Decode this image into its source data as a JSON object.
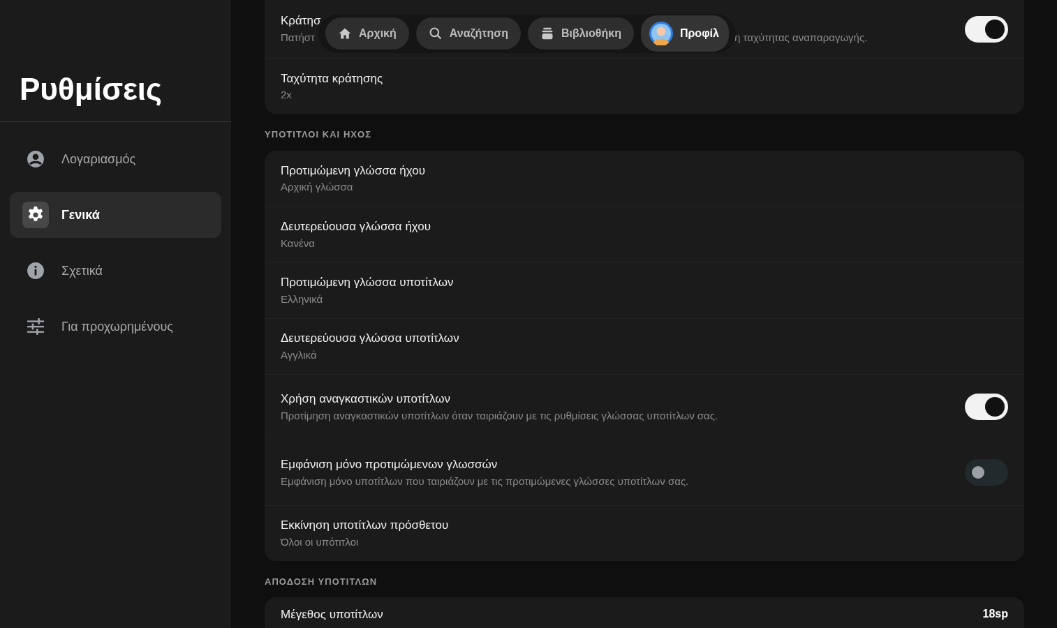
{
  "sidebar": {
    "title": "Ρυθμίσεις",
    "items": [
      {
        "label": "Λογαριασμός",
        "selected": false
      },
      {
        "label": "Γενικά",
        "selected": true
      },
      {
        "label": "Σχετικά",
        "selected": false
      },
      {
        "label": "Για προχωρημένους",
        "selected": false
      }
    ]
  },
  "nav": [
    {
      "label": "Αρχική",
      "selected": false
    },
    {
      "label": "Αναζήτηση",
      "selected": false
    },
    {
      "label": "Βιβλιοθήκη",
      "selected": false
    },
    {
      "label": "Προφίλ",
      "selected": true
    }
  ],
  "sections": [
    {
      "rows": [
        {
          "kind": "toggle",
          "title": "Κράτησ",
          "subtitle_parts": [
            "Πατήστ",
            "η ταχύτητας αναπαραγωγής."
          ],
          "on": true
        },
        {
          "kind": "value",
          "title": "Ταχύτητα κράτησης",
          "subtitle": "2x"
        }
      ]
    },
    {
      "heading": "ΥΠΟΤΙΤΛΟΙ ΚΑΙ ΗΧΟΣ",
      "rows": [
        {
          "kind": "value",
          "title": "Προτιμώμενη γλώσσα ήχου",
          "subtitle": "Αρχική γλώσσα"
        },
        {
          "kind": "value",
          "title": "Δευτερεύουσα γλώσσα ήχου",
          "subtitle": "Κανένα"
        },
        {
          "kind": "value",
          "title": "Προτιμώμενη γλώσσα υποτίτλων",
          "subtitle": "Ελληνικά"
        },
        {
          "kind": "value",
          "title": "Δευτερεύουσα γλώσσα υποτίτλων",
          "subtitle": "Αγγλικά"
        },
        {
          "kind": "toggle",
          "title": "Χρήση αναγκαστικών υποτίτλων",
          "subtitle": "Προτίμηση αναγκαστικών υποτίτλων όταν ταιριάζουν με τις ρυθμίσεις γλώσσας υποτίτλων σας.",
          "on": true
        },
        {
          "kind": "toggle",
          "title": "Εμφάνιση μόνο προτιμώμενων γλωσσών",
          "subtitle": "Εμφάνιση μόνο υποτίτλων που ταιριάζουν με τις προτιμώμενες γλώσσες υποτίτλων σας.",
          "on": false
        },
        {
          "kind": "value",
          "title": "Εκκίνηση υποτίτλων πρόσθετου",
          "subtitle": "Όλοι οι υπότιτλοι"
        }
      ]
    },
    {
      "heading": "ΑΠΟΔΟΣΗ ΥΠΟΤΙΤΛΩΝ",
      "rows": [
        {
          "kind": "value",
          "title": "Μέγεθος υποτίτλων",
          "value": "18sp"
        }
      ]
    }
  ]
}
